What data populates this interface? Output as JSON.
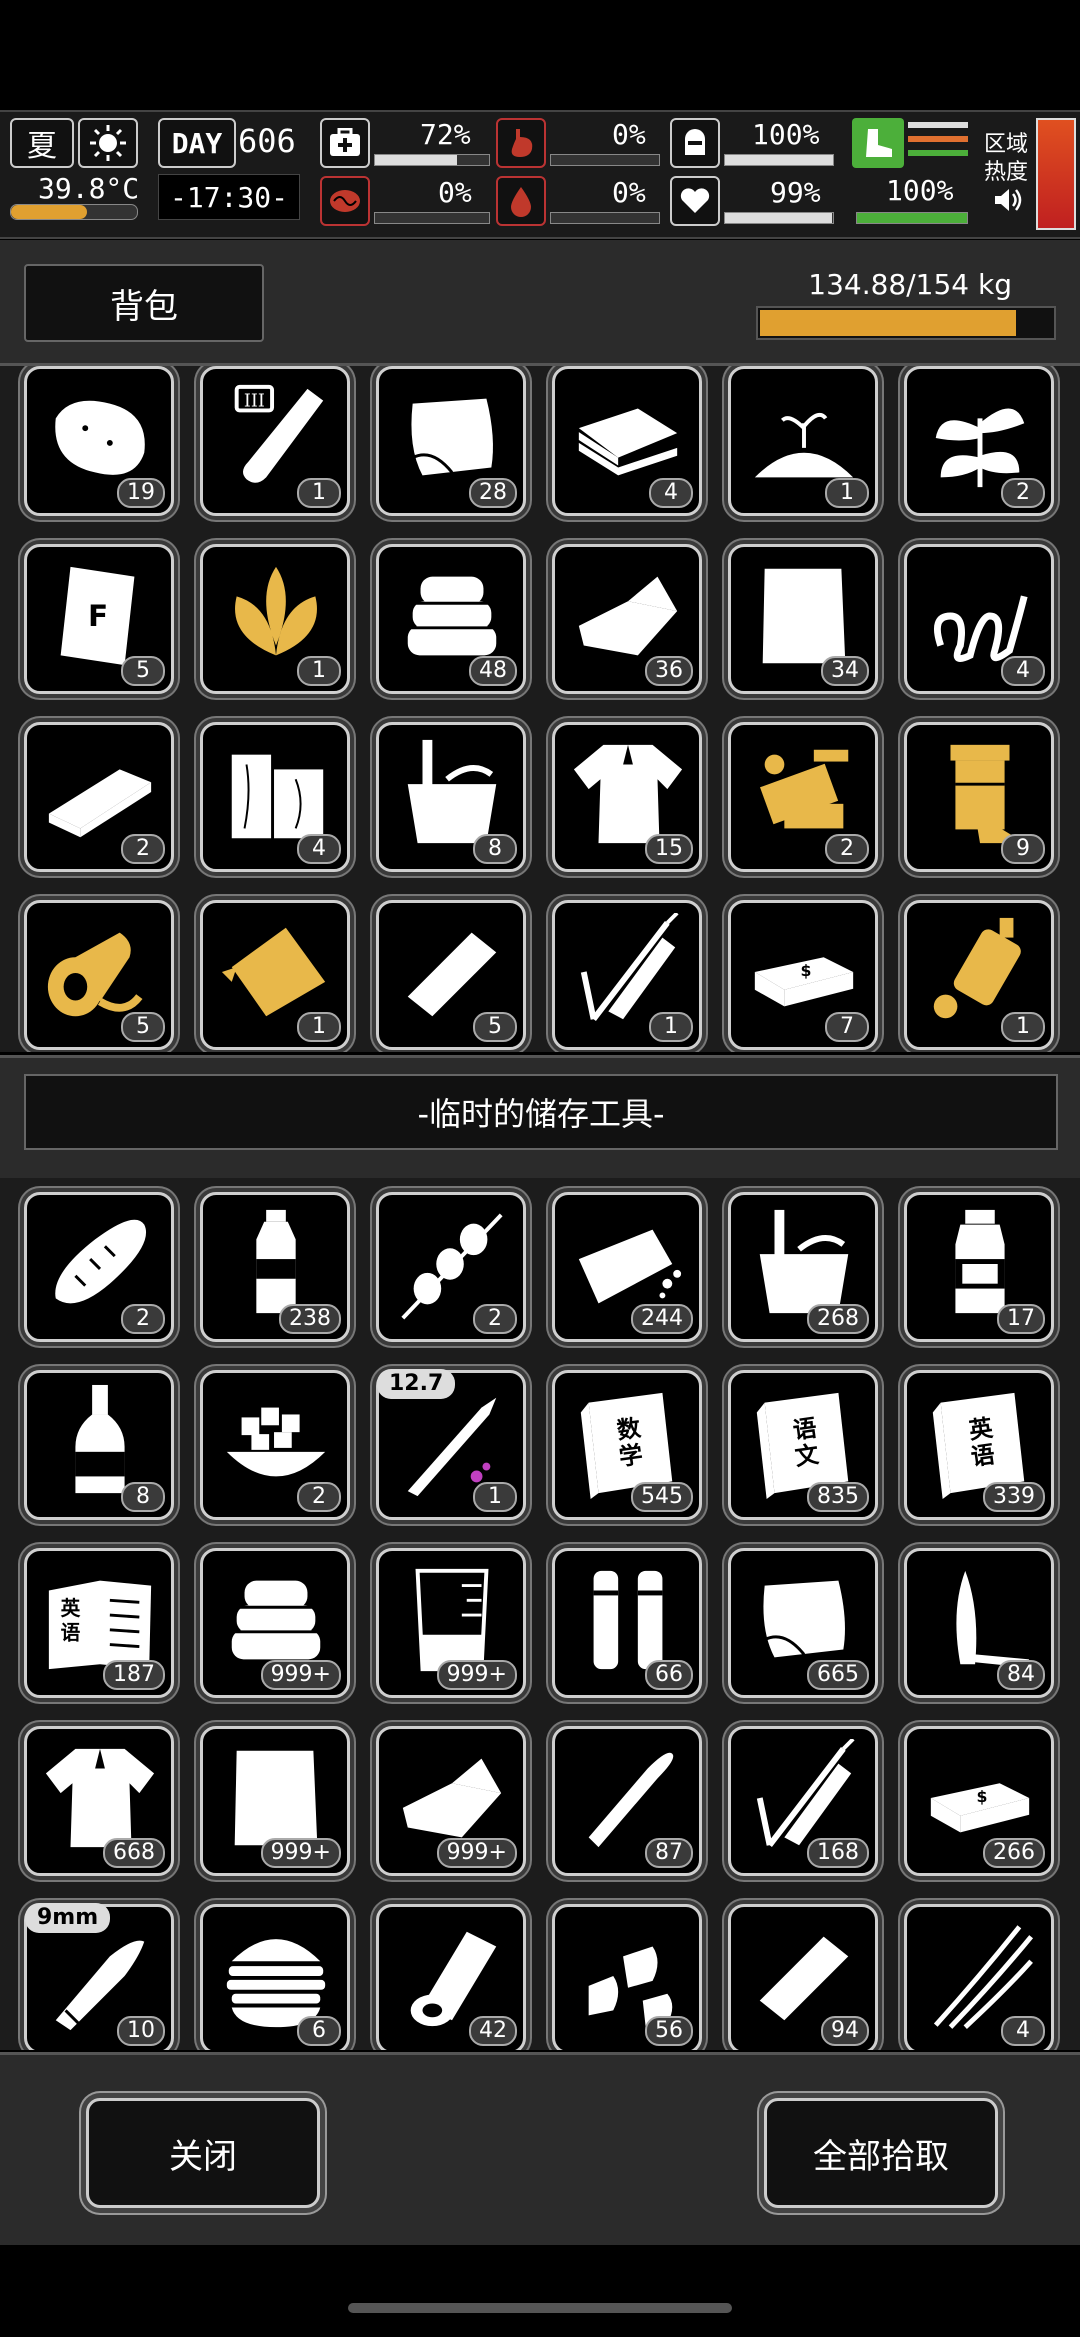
{
  "status": {
    "season": "夏",
    "temperature": "39.8°C",
    "day_label": "DAY",
    "day": "606",
    "time": "-17:30-",
    "health": "72%",
    "health_level": 0.72,
    "hunger": "0%",
    "hunger_level": 0.0,
    "stamina": "100%",
    "stamina_level": 1.0,
    "brain": "0%",
    "brain_level": 0.0,
    "thirst": "0%",
    "thirst_level": 0.0,
    "mood": "99%",
    "mood_level": 0.99,
    "energy": "100%",
    "energy_level": 1.0,
    "zone_line1": "区域",
    "zone_line2": "热度"
  },
  "backpack": {
    "tab_label": "背包",
    "weight": "134.88/154 kg",
    "weight_fraction": 0.876,
    "items": [
      {
        "icon": "potato-icon",
        "count": "19",
        "color": "#ffffff"
      },
      {
        "icon": "test-tube-icon",
        "count": "1",
        "color": "#ffffff"
      },
      {
        "icon": "cloth-icon",
        "count": "28",
        "color": "#ffffff"
      },
      {
        "icon": "brick-stack-icon",
        "count": "4",
        "color": "#ffffff"
      },
      {
        "icon": "soil-sprout-icon",
        "count": "1",
        "color": "#ffffff"
      },
      {
        "icon": "plant-icon",
        "count": "2",
        "color": "#ffffff"
      },
      {
        "icon": "flour-bag-icon",
        "count": "5",
        "color": "#ffffff"
      },
      {
        "icon": "tobacco-leaf-icon",
        "count": "1",
        "color": "#e8b84a"
      },
      {
        "icon": "towel-stack-icon",
        "count": "48",
        "color": "#ffffff"
      },
      {
        "icon": "folded-cloth-icon",
        "count": "36",
        "color": "#ffffff"
      },
      {
        "icon": "paper-sheet-icon",
        "count": "34",
        "color": "#ffffff"
      },
      {
        "icon": "spring-icon",
        "count": "4",
        "color": "#ffffff"
      },
      {
        "icon": "board-icon",
        "count": "2",
        "color": "#ffffff"
      },
      {
        "icon": "wood-plank-icon",
        "count": "4",
        "color": "#ffffff"
      },
      {
        "icon": "bucket-icon",
        "count": "8",
        "color": "#ffffff"
      },
      {
        "icon": "torn-shirt-icon",
        "count": "15",
        "color": "#ffffff"
      },
      {
        "icon": "circuit-part-icon",
        "count": "2",
        "color": "#e8b84a"
      },
      {
        "icon": "pipe-fitting-icon",
        "count": "9",
        "color": "#e8b84a"
      },
      {
        "icon": "pipe-elbow-icon",
        "count": "5",
        "color": "#e8b84a"
      },
      {
        "icon": "metal-plate-icon",
        "count": "1",
        "color": "#e8b84a"
      },
      {
        "icon": "wrapped-bar-icon",
        "count": "5",
        "color": "#ffffff"
      },
      {
        "icon": "syringe-icon",
        "count": "1",
        "color": "#ffffff"
      },
      {
        "icon": "cash-stack-icon",
        "count": "7",
        "color": "#ffffff"
      },
      {
        "icon": "engine-part-icon",
        "count": "1",
        "color": "#e8b84a"
      }
    ]
  },
  "storage": {
    "title": "-临时的储存工具-",
    "items": [
      {
        "icon": "bread-icon",
        "count": "2",
        "color": "#ffffff"
      },
      {
        "icon": "water-bottle-icon",
        "count": "238",
        "color": "#ffffff"
      },
      {
        "icon": "skewer-icon",
        "count": "2",
        "color": "#ffffff"
      },
      {
        "icon": "broken-brick-icon",
        "count": "244",
        "color": "#ffffff"
      },
      {
        "icon": "bucket-icon",
        "count": "268",
        "color": "#ffffff"
      },
      {
        "icon": "sauce-bottle-icon",
        "count": "17",
        "color": "#ffffff"
      },
      {
        "icon": "liquor-bottle-icon",
        "count": "8",
        "color": "#ffffff"
      },
      {
        "icon": "rice-bowl-icon",
        "count": "2",
        "color": "#ffffff"
      },
      {
        "icon": "rifle-cartridge-icon",
        "count": "1",
        "color": "#ffffff",
        "badge": "12.7"
      },
      {
        "icon": "math-book-icon",
        "count": "545",
        "color": "#ffffff",
        "text": "数学"
      },
      {
        "icon": "chinese-book-icon",
        "count": "835",
        "color": "#ffffff",
        "text": "语文"
      },
      {
        "icon": "english-book-icon",
        "count": "339",
        "color": "#ffffff",
        "text": "英语"
      },
      {
        "icon": "english-notebook-icon",
        "count": "187",
        "color": "#ffffff",
        "text": "英语"
      },
      {
        "icon": "towel-stack-icon",
        "count": "999+",
        "color": "#ffffff"
      },
      {
        "icon": "beaker-icon",
        "count": "999+",
        "color": "#ffffff"
      },
      {
        "icon": "battery-pair-icon",
        "count": "66",
        "color": "#ffffff"
      },
      {
        "icon": "cloth-icon",
        "count": "665",
        "color": "#ffffff"
      },
      {
        "icon": "knife-icon",
        "count": "84",
        "color": "#ffffff"
      },
      {
        "icon": "torn-shirt-icon",
        "count": "668",
        "color": "#ffffff"
      },
      {
        "icon": "paper-sheet-icon",
        "count": "999+",
        "color": "#ffffff"
      },
      {
        "icon": "folded-cloth-icon",
        "count": "999+",
        "color": "#ffffff"
      },
      {
        "icon": "bullet-icon",
        "count": "87",
        "color": "#ffffff"
      },
      {
        "icon": "syringe-icon",
        "count": "168",
        "color": "#ffffff"
      },
      {
        "icon": "cash-stack-icon",
        "count": "266",
        "color": "#ffffff"
      },
      {
        "icon": "pistol-round-icon",
        "count": "10",
        "color": "#ffffff",
        "badge": "9mm"
      },
      {
        "icon": "burger-icon",
        "count": "6",
        "color": "#ffffff"
      },
      {
        "icon": "paper-roll-icon",
        "count": "42",
        "color": "#ffffff"
      },
      {
        "icon": "shotgun-shells-icon",
        "count": "56",
        "color": "#ffffff"
      },
      {
        "icon": "wrapped-bar-icon",
        "count": "94",
        "color": "#ffffff"
      },
      {
        "icon": "claw-icon",
        "count": "4",
        "color": "#ffffff"
      }
    ]
  },
  "footer": {
    "close_label": "关闭",
    "pickup_all_label": "全部拾取"
  }
}
